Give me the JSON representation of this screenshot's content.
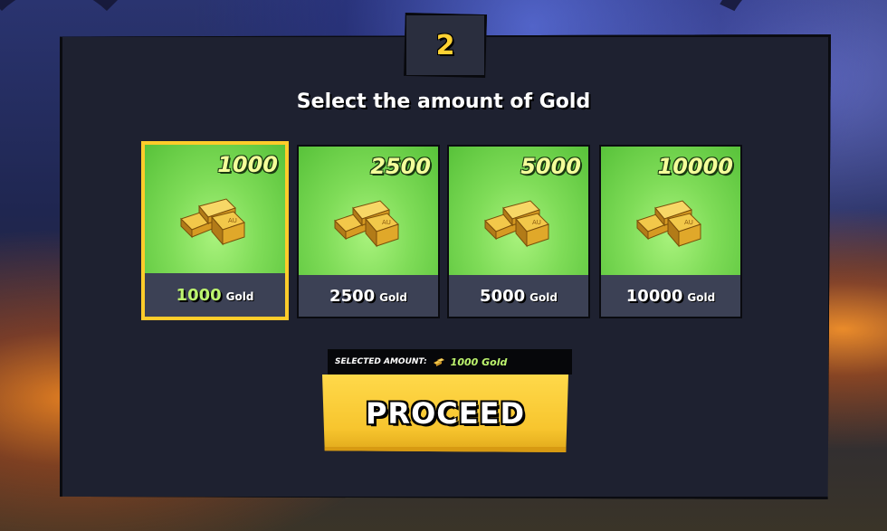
{
  "step": {
    "number": "2"
  },
  "heading": "Select the amount of Gold",
  "options": [
    {
      "amount": "1000",
      "label_value": "1000",
      "label_unit": "Gold",
      "selected": true
    },
    {
      "amount": "2500",
      "label_value": "2500",
      "label_unit": "Gold",
      "selected": false
    },
    {
      "amount": "5000",
      "label_value": "5000",
      "label_unit": "Gold",
      "selected": false
    },
    {
      "amount": "10000",
      "label_value": "10000",
      "label_unit": "Gold",
      "selected": false
    }
  ],
  "selected_amount": {
    "label": "SELECTED AMOUNT:",
    "value": "1000 Gold",
    "icon": "gold-bars-icon"
  },
  "proceed_label": "PROCEED",
  "colors": {
    "accent_yellow": "#ffcc2a",
    "card_green": "#7fdc58",
    "selected_text_green": "#bdf56e",
    "panel_bg": "#1e2130"
  }
}
